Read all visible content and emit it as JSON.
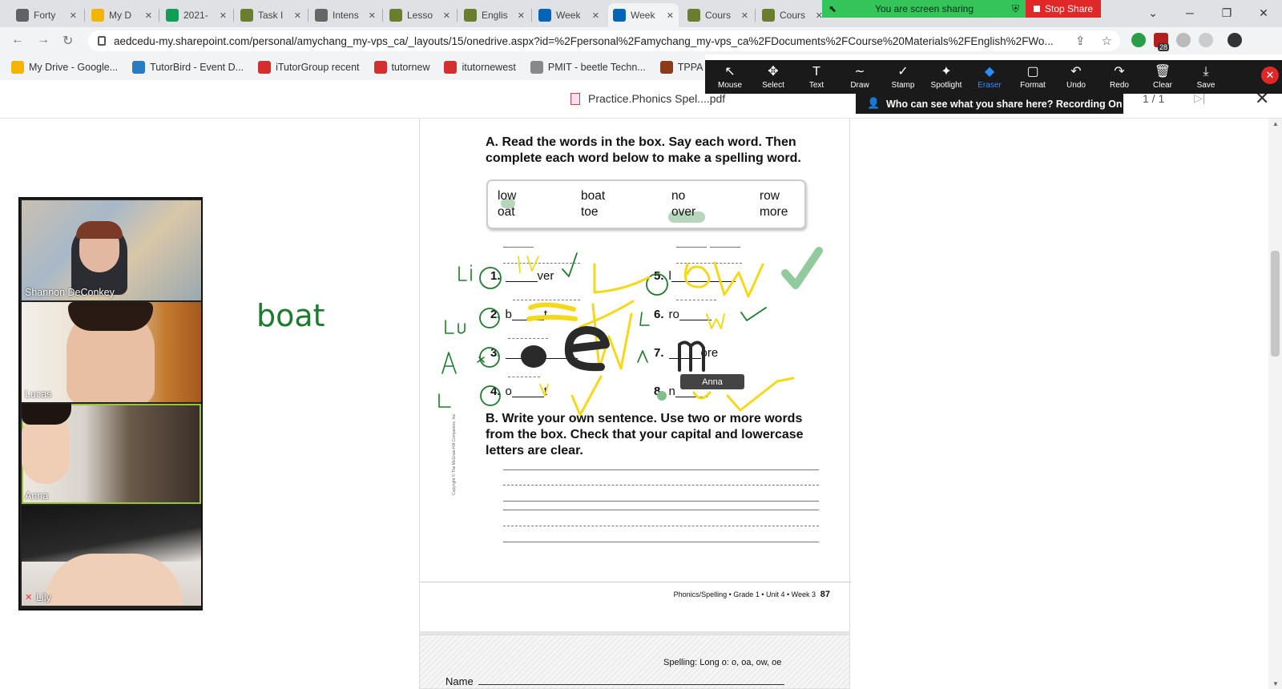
{
  "browser": {
    "tabs": [
      {
        "label": "Forty",
        "icon": "gear-icon",
        "color": "#5f6368"
      },
      {
        "label": "My D",
        "icon": "drive-icon",
        "color": "#f4b400"
      },
      {
        "label": "2021-",
        "icon": "sheets-icon",
        "color": "#0f9d58"
      },
      {
        "label": "Task I",
        "icon": "doc-icon",
        "color": "#6b7d2e"
      },
      {
        "label": "Intens",
        "icon": "globe-icon",
        "color": "#666"
      },
      {
        "label": "Lesso",
        "icon": "doc-icon",
        "color": "#6b7d2e"
      },
      {
        "label": "Englis",
        "icon": "doc-icon",
        "color": "#6b7d2e"
      },
      {
        "label": "Week",
        "icon": "onedrive-icon",
        "color": "#0364b8"
      },
      {
        "label": "Week",
        "icon": "onedrive-icon",
        "color": "#0364b8"
      },
      {
        "label": "Cours",
        "icon": "doc-icon",
        "color": "#6b7d2e"
      },
      {
        "label": "Cours",
        "icon": "doc-icon",
        "color": "#6b7d2e"
      }
    ],
    "url": "aedcedu-my.sharepoint.com/personal/amychang_my-vps_ca/_layouts/15/onedrive.aspx?id=%2Fpersonal%2Famychang_my-vps_ca%2FDocuments%2FCourse%20Materials%2FEnglish%2FWo...",
    "bookmarks": [
      {
        "label": "My Drive - Google...",
        "color": "#f4b400"
      },
      {
        "label": "TutorBird - Event D...",
        "color": "#2a7bbf"
      },
      {
        "label": "iTutorGroup recent",
        "color": "#d32f2f"
      },
      {
        "label": "tutornew",
        "color": "#d32f2f"
      },
      {
        "label": "itutornewest",
        "color": "#d32f2f"
      },
      {
        "label": "PMIT - beetle Techn...",
        "color": "#888"
      },
      {
        "label": "TPPA scho",
        "color": "#8b3a1a"
      }
    ],
    "extension_badge": "28"
  },
  "zoom": {
    "sharing_text": "You are screen sharing",
    "stop_share": "Stop Share",
    "tools": [
      {
        "label": "Mouse",
        "icon": "cursor-icon",
        "glyph": "↖"
      },
      {
        "label": "Select",
        "icon": "move-icon",
        "glyph": "✥"
      },
      {
        "label": "Text",
        "icon": "text-icon",
        "glyph": "T"
      },
      {
        "label": "Draw",
        "icon": "draw-icon",
        "glyph": "∼"
      },
      {
        "label": "Stamp",
        "icon": "stamp-icon",
        "glyph": "✓"
      },
      {
        "label": "Spotlight",
        "icon": "spotlight-icon",
        "glyph": "✦"
      },
      {
        "label": "Eraser",
        "icon": "eraser-icon",
        "glyph": "◆"
      },
      {
        "label": "Format",
        "icon": "format-icon",
        "glyph": "▢"
      },
      {
        "label": "Undo",
        "icon": "undo-icon",
        "glyph": "↶"
      },
      {
        "label": "Redo",
        "icon": "redo-icon",
        "glyph": "↷"
      },
      {
        "label": "Clear",
        "icon": "trash-icon",
        "glyph": "🗑"
      },
      {
        "label": "Save",
        "icon": "save-icon",
        "glyph": "⤓"
      }
    ],
    "who_can_see": "Who can see what you share here? Recording On",
    "participants": [
      "Shannon DeConkey",
      "Lucas",
      "Anna",
      "Lily"
    ],
    "annotator_tag": "Anna",
    "handwriting": "boat"
  },
  "pdf": {
    "filename": "Practice.Phonics Spel....pdf",
    "page_count": "1 / 1",
    "instruction_a": "A. Read the words in the box. Say each word. Then complete each word below to make a spelling word.",
    "word_box": [
      "low",
      "boat",
      "no",
      "row",
      "oat",
      "toe",
      "over",
      "more"
    ],
    "items": [
      {
        "num": "1.",
        "before": "",
        "after": "ver"
      },
      {
        "num": "2.",
        "before": "b",
        "after": "t"
      },
      {
        "num": "3.",
        "before": "",
        "after": "e"
      },
      {
        "num": "4.",
        "before": "o",
        "after": "t"
      },
      {
        "num": "5.",
        "before": "l",
        "after": ""
      },
      {
        "num": "6.",
        "before": "ro",
        "after": ""
      },
      {
        "num": "7.",
        "before": "",
        "after": "ore"
      },
      {
        "num": "8.",
        "before": "n",
        "after": ""
      }
    ],
    "instruction_b": "B. Write your own sentence. Use two or more words from the box. Check that your capital and lowercase letters are clear.",
    "copyright": "Copyright © The McGraw-Hill Companies, Inc.",
    "footer_text": "Phonics/Spelling • Grade 1 • Unit 4 • Week 3",
    "page_number": "87",
    "next_page_header": "Spelling: Long o: o, oa, ow, oe",
    "name_label": "Name"
  },
  "colors": {
    "ink_green": "#1e7a2e",
    "ink_yellow": "#f4d81c",
    "ink_black": "#2a2a2a",
    "highlight": "#7fbf8c"
  }
}
